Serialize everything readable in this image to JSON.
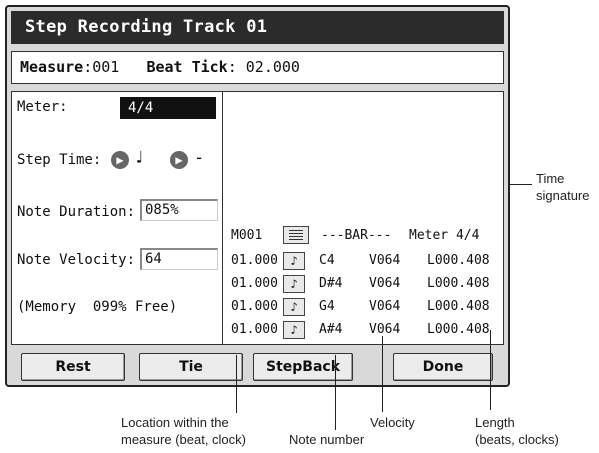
{
  "window": {
    "title": "Step Recording Track 01"
  },
  "measure_bar": {
    "measure_label": "Measure",
    "measure_value": ":001",
    "beat_tick_label": "Beat Tick",
    "beat_tick_value": ": 02.000"
  },
  "left": {
    "meter_label": "Meter:",
    "meter_value": "4/4",
    "step_time_label": "Step Time:",
    "step_time_note": "♩",
    "step_time_mod": "-",
    "note_duration_label": "Note Duration:",
    "note_duration_value": "085%",
    "note_velocity_label": "Note Velocity:",
    "note_velocity_value": "64",
    "memory_text": "(Memory  099% Free)"
  },
  "events": {
    "header": {
      "measure": "M001",
      "bar": "---BAR---",
      "meter": "Meter 4/4"
    },
    "rows": [
      {
        "loc": "01.000",
        "note": "C4",
        "vel": "V064",
        "len": "L000.408"
      },
      {
        "loc": "01.000",
        "note": "D#4",
        "vel": "V064",
        "len": "L000.408"
      },
      {
        "loc": "01.000",
        "note": "G4",
        "vel": "V064",
        "len": "L000.408"
      },
      {
        "loc": "01.000",
        "note": "A#4",
        "vel": "V064",
        "len": "L000.408"
      }
    ]
  },
  "buttons": {
    "rest": "Rest",
    "tie": "Tie",
    "stepback": "StepBack",
    "done": "Done"
  },
  "callouts": {
    "time_signature_1": "Time",
    "time_signature_2": "signature",
    "location_1": "Location within the",
    "location_2": "measure (beat, clock)",
    "note_number": "Note number",
    "velocity": "Velocity",
    "length_1": "Length",
    "length_2": "(beats, clocks)"
  },
  "icons": {
    "step_arrow": "chevron-right-icon",
    "note_button": "eighth-note-icon",
    "list": "list-icon"
  }
}
